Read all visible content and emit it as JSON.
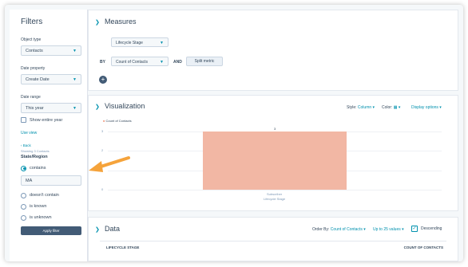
{
  "sidebar": {
    "title": "Filters",
    "object_type": {
      "label": "Object type",
      "value": "Contacts"
    },
    "date_property": {
      "label": "Date property",
      "value": "Create Date"
    },
    "date_range": {
      "label": "Date range",
      "value": "This year"
    },
    "show_entire_year": "Show entire year",
    "use_view": "Use view",
    "back": "‹ Back",
    "showing": "Showing 3 Contacts",
    "property": "State/Region",
    "options": [
      {
        "label": "contains",
        "selected": true
      },
      {
        "label": "doesn't contain",
        "selected": false
      },
      {
        "label": "is known",
        "selected": false
      },
      {
        "label": "is unknown",
        "selected": false
      }
    ],
    "contains_value": "MA",
    "apply": "Apply filter"
  },
  "measures": {
    "title": "Measures",
    "dimension": "Lifecycle Stage",
    "by": "BY",
    "metric": "Count of Contacts",
    "and": "AND",
    "split": "Split metric",
    "add": "+"
  },
  "visualization": {
    "title": "Visualization",
    "style_label": "Style:",
    "style_value": "Column",
    "color_label": "Color:",
    "display_options": "Display options"
  },
  "chart_data": {
    "type": "bar",
    "legend": "Count of Contacts",
    "categories": [
      "Subscriber"
    ],
    "values": [
      3
    ],
    "data_labels": [
      "3"
    ],
    "y_ticks": [
      "3",
      "2",
      "1",
      "0"
    ],
    "ylim": [
      0,
      3
    ],
    "xlabel": "Lifecycle Stage",
    "bar_color": "#f2b7a4"
  },
  "data": {
    "title": "Data",
    "order_by_label": "Order By:",
    "order_by_value": "Count of Contacts",
    "limit_value": "Up to 25 values",
    "descending": "Descending",
    "columns": [
      "LIFECYCLE STAGE",
      "COUNT OF CONTACTS"
    ]
  },
  "colors": {
    "accent": "#0091ae",
    "button": "#425b76",
    "arrow": "#f5a33b"
  }
}
